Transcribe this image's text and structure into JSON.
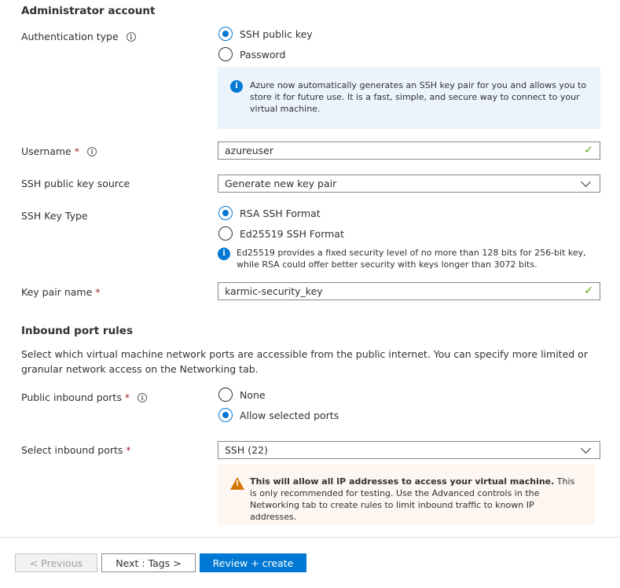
{
  "admin": {
    "title": "Administrator account",
    "auth_type_label": "Authentication type",
    "auth_options": [
      "SSH public key",
      "Password"
    ],
    "auth_selected": "SSH public key",
    "info_text": "Azure now automatically generates an SSH key pair for you and allows you to store it for future use. It is a fast, simple, and secure way to connect to your virtual machine.",
    "username_label": "Username",
    "username_value": "azureuser",
    "key_source_label": "SSH public key source",
    "key_source_value": "Generate new key pair",
    "key_type_label": "SSH Key Type",
    "key_type_options": [
      "RSA SSH Format",
      "Ed25519 SSH Format"
    ],
    "key_type_selected": "RSA SSH Format",
    "key_type_hint": "Ed25519 provides a fixed security level of no more than 128 bits for 256-bit key, while RSA could offer better security with keys longer than 3072 bits.",
    "key_pair_label": "Key pair name",
    "key_pair_value": "karmic-security_key"
  },
  "inbound": {
    "title": "Inbound port rules",
    "description": "Select which virtual machine network ports are accessible from the public internet. You can specify more limited or granular network access on the Networking tab.",
    "public_ports_label": "Public inbound ports",
    "public_ports_options": [
      "None",
      "Allow selected ports"
    ],
    "public_ports_selected": "Allow selected ports",
    "select_ports_label": "Select inbound ports",
    "select_ports_value": "SSH (22)",
    "warning_bold": "This will allow all IP addresses to access your virtual machine.",
    "warning_text": "This is only recommended for testing.  Use the Advanced controls in the Networking tab to create rules to limit inbound traffic to known IP addresses."
  },
  "footer": {
    "previous": "< Previous",
    "next": "Next : Tags >",
    "review": "Review + create"
  },
  "colors": {
    "accent": "#0078d4",
    "success": "#57a300",
    "warning": "#d47500",
    "required": "#a4262c"
  },
  "icons": {
    "info": "info-circle-icon",
    "check": "checkmark-icon",
    "chevron": "chevron-down-icon",
    "warning": "warning-icon"
  }
}
